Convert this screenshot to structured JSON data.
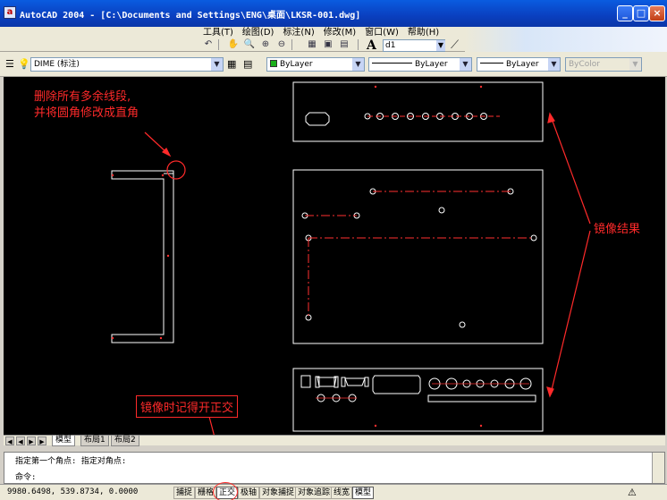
{
  "window": {
    "title": "AutoCAD 2004 - [C:\\Documents and Settings\\ENG\\桌面\\LKSR-001.dwg]",
    "minimize": "_",
    "maximize": "□",
    "close": "×"
  },
  "menu": {
    "items": [
      "工具(T)",
      "绘图(D)",
      "标注(N)",
      "修改(M)",
      "窗口(W)",
      "帮助(H)"
    ]
  },
  "text_style": {
    "value": "d1",
    "icon": "text-style-icon"
  },
  "layer": {
    "value": "DIME (标注)",
    "icon": "layer-state-icons"
  },
  "properties": {
    "color": {
      "value": "ByLayer",
      "swatch": "#1bb01b"
    },
    "linetype": {
      "value": "ByLayer"
    },
    "lineweight": {
      "value": "ByLayer"
    },
    "plotstyle": {
      "value": "ByColor"
    }
  },
  "annotations": {
    "delete_note_line1": "删除所有多余线段,",
    "delete_note_line2": "并将圆角修改成直角",
    "mirror_result": "镜像结果",
    "ortho_note": "镜像时记得开正交",
    "color": "#ff2a2a"
  },
  "tabs": {
    "items": [
      {
        "label": "模型",
        "active": true
      },
      {
        "label": "布局1",
        "active": false
      },
      {
        "label": "布局2",
        "active": false
      }
    ]
  },
  "command": {
    "history": "指定第一个角点: 指定对角点:",
    "prompt": "命令:"
  },
  "status": {
    "coordinates": "9980.6498, 539.8734, 0.0000",
    "buttons": [
      {
        "label": "捕捉",
        "pressed": false
      },
      {
        "label": "栅格",
        "pressed": false
      },
      {
        "label": "正交",
        "pressed": true
      },
      {
        "label": "极轴",
        "pressed": false
      },
      {
        "label": "对象捕捉",
        "pressed": false
      },
      {
        "label": "对象追踪",
        "pressed": false
      },
      {
        "label": "线宽",
        "pressed": false
      },
      {
        "label": "模型",
        "pressed": true
      }
    ]
  }
}
